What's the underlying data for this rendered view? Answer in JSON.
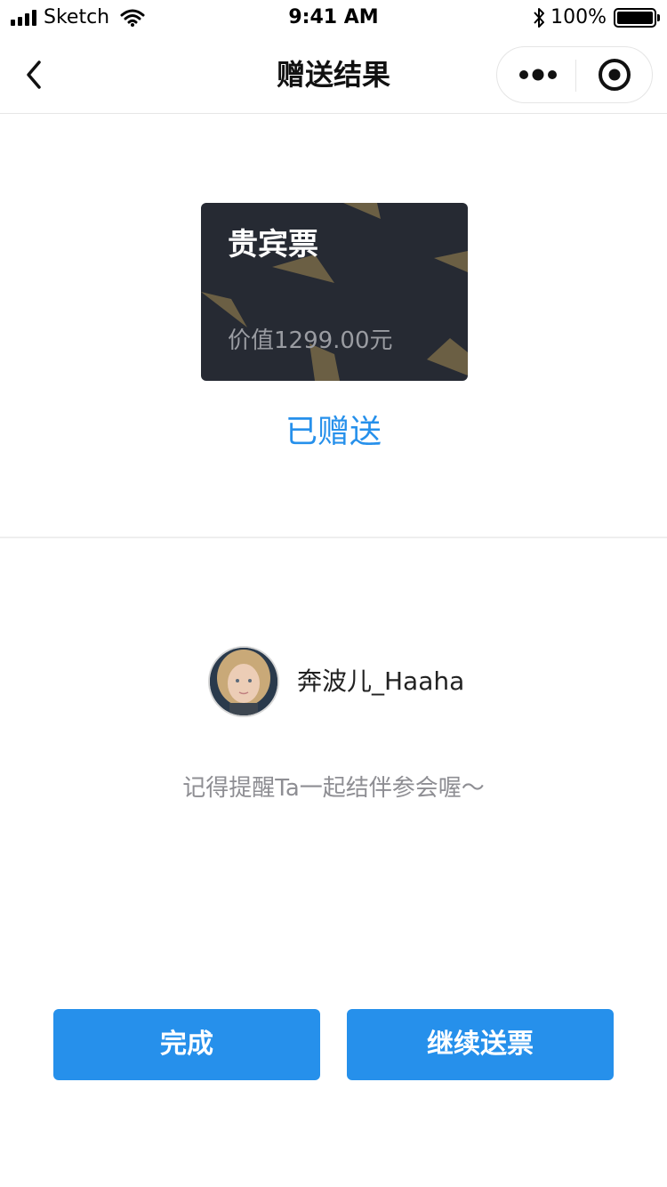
{
  "status_bar": {
    "carrier": "Sketch",
    "time": "9:41 AM",
    "battery": "100%"
  },
  "nav": {
    "title": "赠送结果",
    "back_icon": "chevron-left-icon",
    "more_icon": "more-dots-icon",
    "close_icon": "target-circle-icon"
  },
  "ticket": {
    "name": "贵宾票",
    "value": "价值1299.00元"
  },
  "gift_status": "已赠送",
  "recipient": {
    "name": "奔波儿_Haaha"
  },
  "reminder": "记得提醒Ta一起结伴参会喔～",
  "buttons": {
    "done": "完成",
    "continue": "继续送票"
  },
  "colors": {
    "accent": "#2690eb",
    "card_bg": "#262a33",
    "card_deco": "#6b5f44"
  }
}
